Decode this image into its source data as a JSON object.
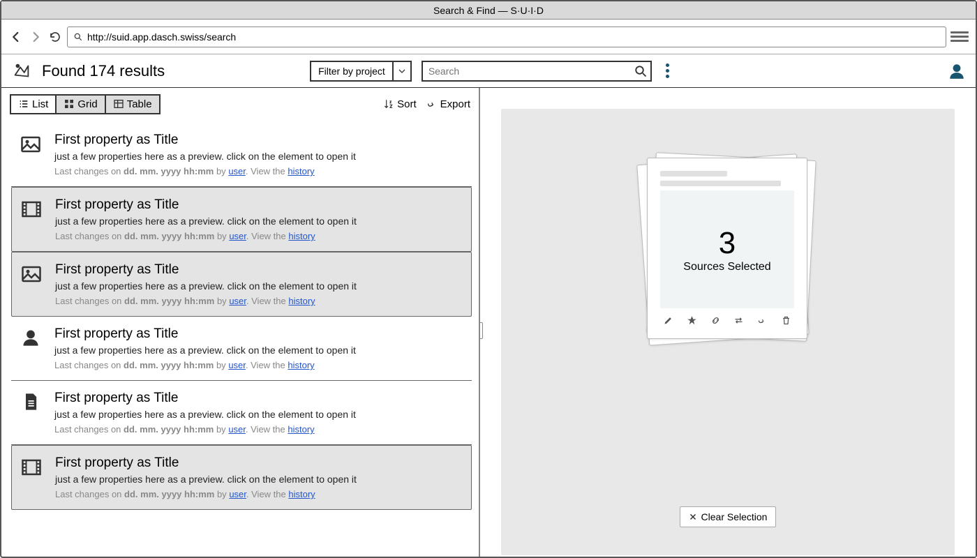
{
  "window": {
    "title": "Search & Find — S·U·I·D"
  },
  "browser": {
    "url": "http://suid.app.dasch.swiss/search"
  },
  "header": {
    "title": "Found 174 results",
    "filter_label": "Filter by project",
    "search_placeholder": "Search"
  },
  "tabs": {
    "list": "List",
    "grid": "Grid",
    "table": "Table"
  },
  "tools": {
    "sort": "Sort",
    "export": "Export"
  },
  "result_template": {
    "title": "First property as Title",
    "preview": "just a few properties here as a preview. click on the element to open it",
    "meta_prefix": "Last changes on ",
    "meta_date": "dd. mm. yyyy hh:mm",
    "meta_by": " by ",
    "meta_user": "user",
    "meta_view": ". View the ",
    "meta_history": "history"
  },
  "results": [
    {
      "icon": "image",
      "selected": false
    },
    {
      "icon": "film",
      "selected": true
    },
    {
      "icon": "image",
      "selected": true
    },
    {
      "icon": "person",
      "selected": false
    },
    {
      "icon": "document",
      "selected": false
    },
    {
      "icon": "film",
      "selected": true
    }
  ],
  "selection": {
    "count": "3",
    "label": "Sources Selected",
    "clear": "Clear Selection"
  }
}
